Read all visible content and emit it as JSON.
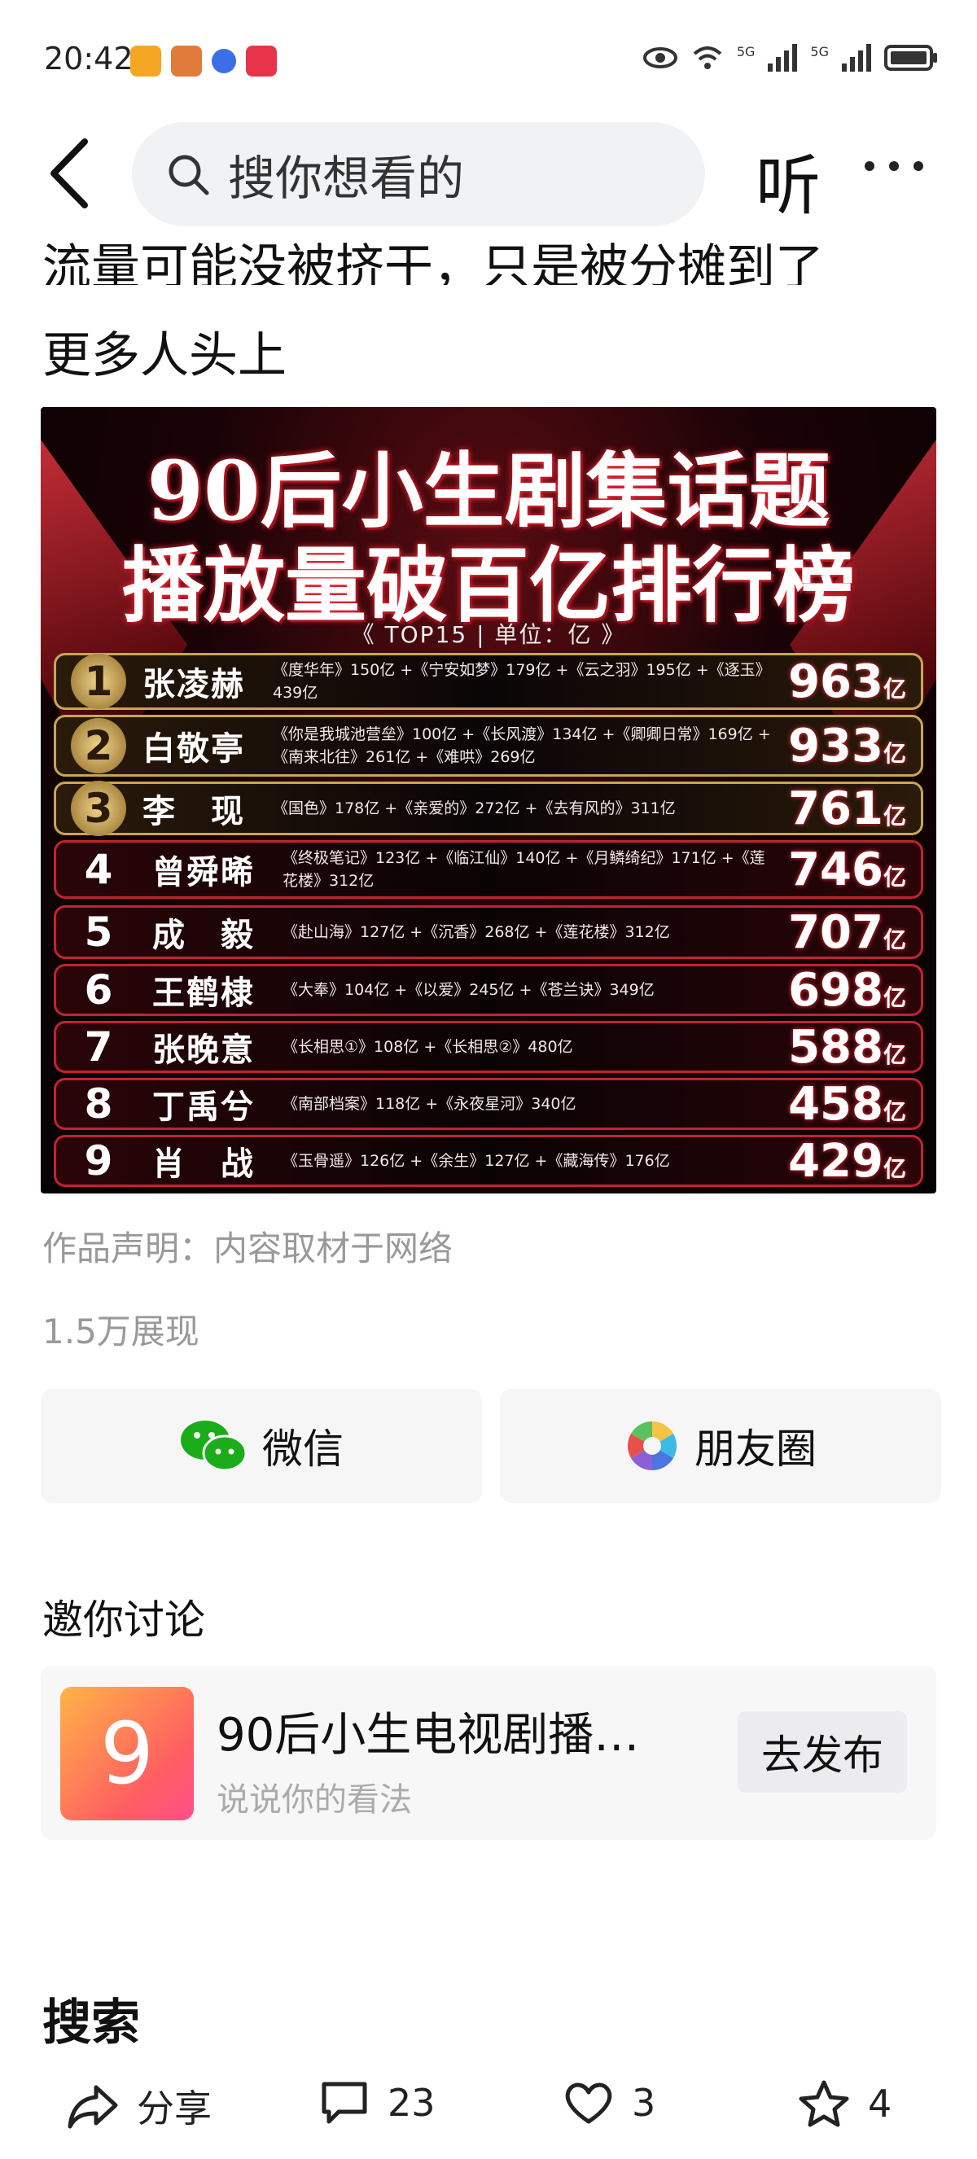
{
  "status_bar": {
    "time": "20:42",
    "net1": "5G",
    "net2": "5G"
  },
  "nav": {
    "search_placeholder": "搜你想看的",
    "listen_label": "听"
  },
  "article": {
    "text_line1": "流量可能没被挤干，只是被分摊到了",
    "text_line2": "更多人头上"
  },
  "poster": {
    "title_line1": "90后小生剧集话题",
    "title_line2": "播放量破百亿排行榜",
    "subtitle": "《 TOP15 | 单位：亿 》",
    "rows": [
      {
        "rank": "1",
        "name": "张凌赫",
        "works": "《度华年》150亿 +《宁安如梦》179亿 +《云之羽》195亿 +《逐玉》439亿",
        "total": "963",
        "unit": "亿",
        "tier": "top"
      },
      {
        "rank": "2",
        "name": "白敬亭",
        "works": "《你是我城池营垒》100亿 +《长风渡》134亿 +《卿卿日常》169亿 +《南来北往》261亿 +《难哄》269亿",
        "total": "933",
        "unit": "亿",
        "tier": "top"
      },
      {
        "rank": "3",
        "name": "李　现",
        "works": "《国色》178亿 +《亲爱的》272亿 +《去有风的》311亿",
        "total": "761",
        "unit": "亿",
        "tier": "top"
      },
      {
        "rank": "4",
        "name": "曾舜晞",
        "works": "《终极笔记》123亿 +《临江仙》140亿 +《月鳞绮纪》171亿 +《莲花楼》312亿",
        "total": "746",
        "unit": "亿",
        "tier": "norm"
      },
      {
        "rank": "5",
        "name": "成　毅",
        "works": "《赴山海》127亿 +《沉香》268亿 +《莲花楼》312亿",
        "total": "707",
        "unit": "亿",
        "tier": "norm"
      },
      {
        "rank": "6",
        "name": "王鹤棣",
        "works": "《大奉》104亿 +《以爱》245亿 +《苍兰诀》349亿",
        "total": "698",
        "unit": "亿",
        "tier": "norm"
      },
      {
        "rank": "7",
        "name": "张晚意",
        "works": "《长相思①》108亿 +《长相思②》480亿",
        "total": "588",
        "unit": "亿",
        "tier": "norm"
      },
      {
        "rank": "8",
        "name": "丁禹兮",
        "works": "《南部档案》118亿 +《永夜星河》340亿",
        "total": "458",
        "unit": "亿",
        "tier": "norm"
      },
      {
        "rank": "9",
        "name": "肖　战",
        "works": "《玉骨遥》126亿 +《余生》127亿 +《藏海传》176亿",
        "total": "429",
        "unit": "亿",
        "tier": "norm"
      }
    ]
  },
  "meta": {
    "declaration": "作品声明：内容取材于网络",
    "views": "1.5万展现"
  },
  "share": {
    "wechat_label": "微信",
    "moments_label": "朋友圈"
  },
  "discussion": {
    "heading": "邀你讨论",
    "topic_icon_text": "9",
    "topic_title": "90后小生电视剧播放...",
    "topic_sub": "说说你的看法",
    "publish_label": "去发布"
  },
  "search_heading": "搜索",
  "bottom_bar": {
    "share_label": "分享",
    "comments": "23",
    "likes": "3",
    "favorites": "4"
  }
}
